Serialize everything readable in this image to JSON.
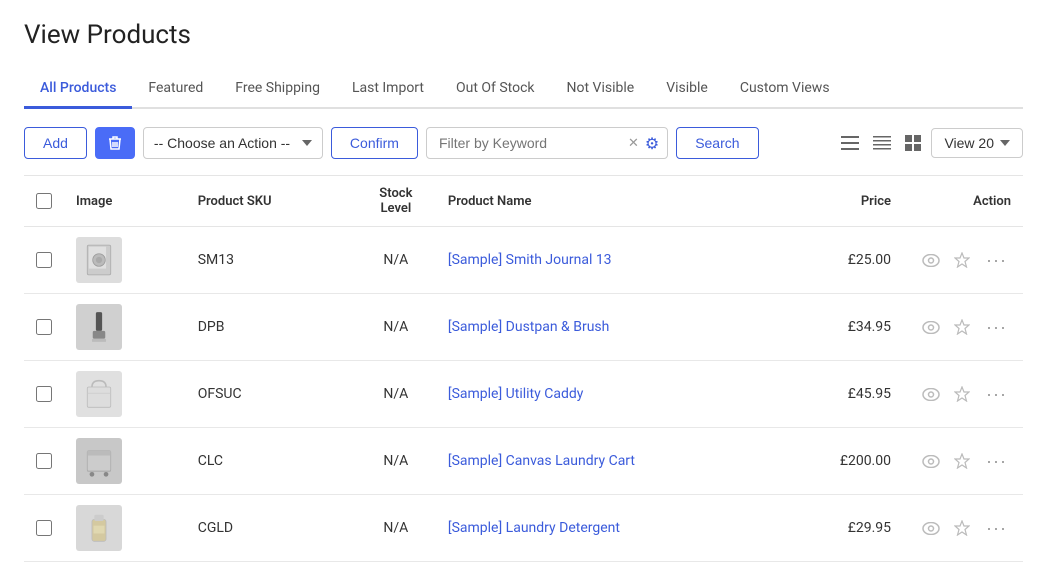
{
  "page": {
    "title": "View Products"
  },
  "tabs": [
    {
      "id": "all",
      "label": "All Products",
      "active": true
    },
    {
      "id": "featured",
      "label": "Featured",
      "active": false
    },
    {
      "id": "free-shipping",
      "label": "Free Shipping",
      "active": false
    },
    {
      "id": "last-import",
      "label": "Last Import",
      "active": false
    },
    {
      "id": "out-of-stock",
      "label": "Out Of Stock",
      "active": false
    },
    {
      "id": "not-visible",
      "label": "Not Visible",
      "active": false
    },
    {
      "id": "visible",
      "label": "Visible",
      "active": false
    },
    {
      "id": "custom-views",
      "label": "Custom Views",
      "active": false
    }
  ],
  "toolbar": {
    "add_label": "Add",
    "action_placeholder": "-- Choose an Action --",
    "confirm_label": "Confirm",
    "filter_placeholder": "Filter by Keyword",
    "search_label": "Search",
    "view_count": "View 20"
  },
  "table": {
    "columns": [
      "Image",
      "Product SKU",
      {
        "line1": "Stock",
        "line2": "Level"
      },
      "Product Name",
      "Price",
      "Action"
    ]
  },
  "products": [
    {
      "sku": "SM13",
      "stock": "N/A",
      "name": "[Sample] Smith Journal 13",
      "price": "£25.00",
      "img_type": "journal"
    },
    {
      "sku": "DPB",
      "stock": "N/A",
      "name": "[Sample] Dustpan & Brush",
      "price": "£34.95",
      "img_type": "brush"
    },
    {
      "sku": "OFSUC",
      "stock": "N/A",
      "name": "[Sample] Utility Caddy",
      "price": "£45.95",
      "img_type": "caddy"
    },
    {
      "sku": "CLC",
      "stock": "N/A",
      "name": "[Sample] Canvas Laundry Cart",
      "price": "£200.00",
      "img_type": "cart"
    },
    {
      "sku": "CGLD",
      "stock": "N/A",
      "name": "[Sample] Laundry Detergent",
      "price": "£29.95",
      "img_type": "detergent"
    }
  ]
}
